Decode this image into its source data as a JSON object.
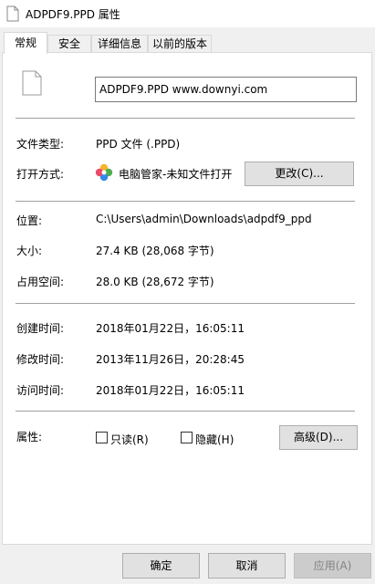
{
  "window": {
    "title": "ADPDF9.PPD 属性"
  },
  "tabs": [
    {
      "label": "常规",
      "active": true
    },
    {
      "label": "安全",
      "active": false
    },
    {
      "label": "详细信息",
      "active": false
    },
    {
      "label": "以前的版本",
      "active": false
    }
  ],
  "file": {
    "name_value": "ADPDF9.PPD      www.downyi.com"
  },
  "general": {
    "type_label": "文件类型:",
    "type_value": "PPD 文件 (.PPD)",
    "opens_label": "打开方式:",
    "opens_app": "电脑管家-未知文件打开",
    "change_button": "更改(C)...",
    "location_label": "位置:",
    "location_value": "C:\\Users\\admin\\Downloads\\adpdf9_ppd",
    "size_label": "大小:",
    "size_value": "27.4 KB (28,068 字节)",
    "disk_label": "占用空间:",
    "disk_value": "28.0 KB (28,672 字节)",
    "created_label": "创建时间:",
    "created_value": "2018年01月22日，16:05:11",
    "modified_label": "修改时间:",
    "modified_value": "2013年11月26日，20:28:45",
    "accessed_label": "访问时间:",
    "accessed_value": "2018年01月22日，16:05:11",
    "attributes_label": "属性:",
    "readonly_label": "只读(R)",
    "readonly_checked": false,
    "hidden_label": "隐藏(H)",
    "hidden_checked": false,
    "advanced_button": "高级(D)..."
  },
  "footer": {
    "ok": "确定",
    "cancel": "取消",
    "apply": "应用(A)"
  },
  "icons": {
    "title": "file-icon",
    "file": "blank-file-icon",
    "app": "pc-manager-icon"
  }
}
